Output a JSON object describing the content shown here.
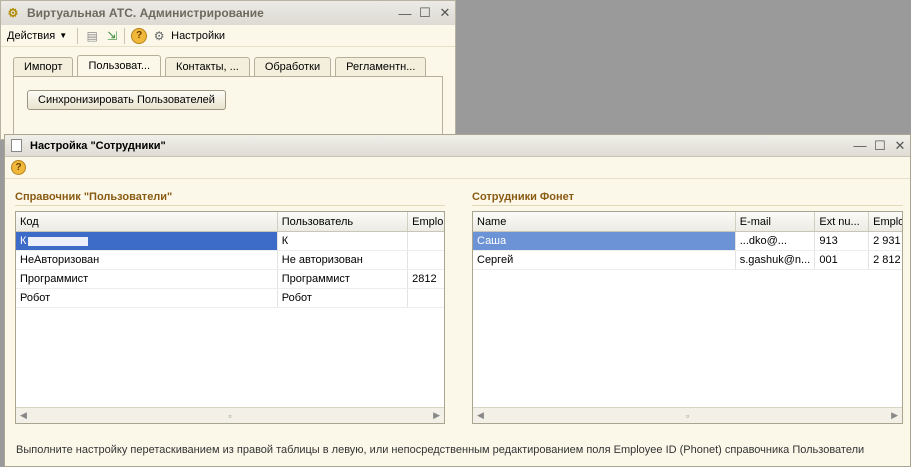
{
  "back_window": {
    "title": "Виртуальная АТС. Администрирование",
    "toolbar": {
      "actions_label": "Действия",
      "settings_label": "Настройки"
    },
    "tabs": [
      "Импорт",
      "Пользоват...",
      "Контакты, ...",
      "Обработки",
      "Регламентн..."
    ],
    "active_tab": 1,
    "sync_button": "Синхронизировать Пользователей"
  },
  "dialog": {
    "title": "Настройка \"Сотрудники\"",
    "left": {
      "title": "Справочник \"Пользователи\"",
      "columns": [
        "Код",
        "Пользователь",
        "Emplo"
      ],
      "rows": [
        [
          "К",
          "К",
          ""
        ],
        [
          "НеАвторизован",
          "Не авторизован",
          ""
        ],
        [
          "Программист",
          "Программист",
          "2812"
        ],
        [
          "Робот",
          "Робот",
          ""
        ]
      ]
    },
    "right": {
      "title": "Сотрудники Фонет",
      "columns": [
        "Name",
        "E-mail",
        "Ext nu...",
        "Emplo"
      ],
      "rows": [
        [
          "Саша",
          "...dko@...",
          "913",
          "2 931"
        ],
        [
          "Сергей",
          "s.gashuk@n...",
          "001",
          "2 812"
        ]
      ]
    },
    "footer": "Выполните настройку перетаскиванием из правой таблицы в левую, или непосредственным редактированием поля Employee ID (Phonet) справочника Пользователи"
  }
}
